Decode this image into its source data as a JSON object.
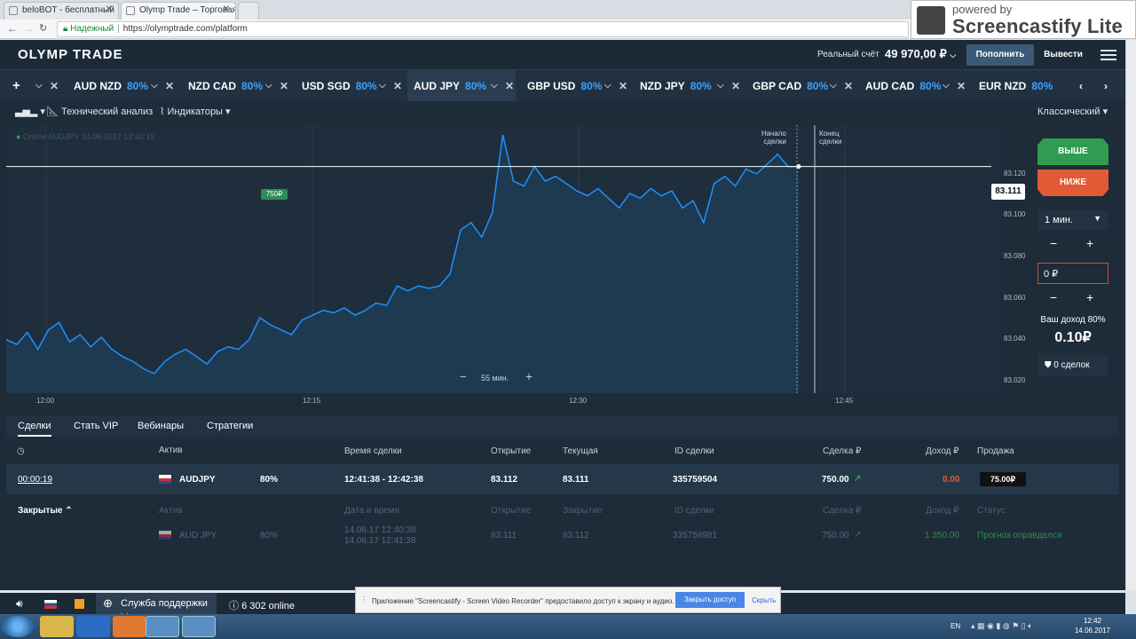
{
  "browser": {
    "tabs": [
      {
        "title": "beloBOT - бесплатный"
      },
      {
        "title": "Olymp Trade – Торговая"
      }
    ],
    "secure_label": "Надежный",
    "url": "https://olymptrade.com/platform"
  },
  "overlay": {
    "powered_by": "powered by",
    "name": "Screencastify Lite"
  },
  "header": {
    "logo": "OLYMP TRADE",
    "balance_label": "Реальный счёт",
    "balance_value": "49 970,00 ₽",
    "deposit_label": "Пополнить",
    "withdraw_label": "Вывести"
  },
  "assets": [
    {
      "name": "AUD NZD",
      "pct": "80%"
    },
    {
      "name": "NZD CAD",
      "pct": "80%"
    },
    {
      "name": "USD SGD",
      "pct": "80%"
    },
    {
      "name": "AUD JPY",
      "pct": "80%",
      "active": true
    },
    {
      "name": "GBP USD",
      "pct": "80%"
    },
    {
      "name": "NZD JPY",
      "pct": "80%"
    },
    {
      "name": "GBP CAD",
      "pct": "80%"
    },
    {
      "name": "AUD CAD",
      "pct": "80%"
    },
    {
      "name": "EUR NZD",
      "pct": "80%"
    }
  ],
  "toolbar": {
    "tech_analysis": "Технический анализ",
    "indicators": "Индикаторы",
    "chart_style": "Классический"
  },
  "chart_data": {
    "type": "area",
    "online_label": "Online AUDJPY 14.06.2017 12:42:19",
    "x_ticks": [
      "12:00",
      "12:15",
      "12:30",
      "12:45"
    ],
    "y_ticks": [
      "83.120",
      "83.100",
      "83.080",
      "83.060",
      "83.040",
      "83.020"
    ],
    "ylim": [
      83.018,
      83.128
    ],
    "current_price": "83.111",
    "amount_marker": "750₽",
    "deal_start_label": [
      "Начало",
      "сделки"
    ],
    "deal_end_label": [
      "Конец",
      "сделки"
    ],
    "zoom_label": "55 мин.",
    "series": [
      {
        "points": [
          [
            0,
            83.04
          ],
          [
            1,
            83.038
          ],
          [
            2,
            83.043
          ],
          [
            3,
            83.036
          ],
          [
            4,
            83.044
          ],
          [
            5,
            83.047
          ],
          [
            6,
            83.039
          ],
          [
            7,
            83.042
          ],
          [
            8,
            83.037
          ],
          [
            9,
            83.041
          ],
          [
            10,
            83.036
          ],
          [
            11,
            83.033
          ],
          [
            12,
            83.031
          ],
          [
            13,
            83.028
          ],
          [
            14,
            83.026
          ],
          [
            15,
            83.031
          ],
          [
            16,
            83.034
          ],
          [
            17,
            83.036
          ],
          [
            18,
            83.033
          ],
          [
            19,
            83.03
          ],
          [
            20,
            83.035
          ],
          [
            21,
            83.037
          ],
          [
            22,
            83.036
          ],
          [
            23,
            83.04
          ],
          [
            24,
            83.049
          ],
          [
            25,
            83.046
          ],
          [
            26,
            83.044
          ],
          [
            27,
            83.042
          ],
          [
            28,
            83.048
          ],
          [
            29,
            83.05
          ],
          [
            30,
            83.052
          ],
          [
            31,
            83.051
          ],
          [
            32,
            83.053
          ],
          [
            33,
            83.05
          ],
          [
            34,
            83.052
          ],
          [
            35,
            83.055
          ],
          [
            36,
            83.054
          ],
          [
            37,
            83.062
          ],
          [
            38,
            83.06
          ],
          [
            39,
            83.062
          ],
          [
            40,
            83.061
          ],
          [
            41,
            83.062
          ],
          [
            42,
            83.067
          ],
          [
            43,
            83.085
          ],
          [
            44,
            83.088
          ],
          [
            45,
            83.082
          ],
          [
            46,
            83.092
          ],
          [
            47,
            83.124
          ],
          [
            48,
            83.105
          ],
          [
            49,
            83.103
          ],
          [
            50,
            83.111
          ],
          [
            51,
            83.105
          ],
          [
            52,
            83.107
          ],
          [
            53,
            83.104
          ],
          [
            54,
            83.101
          ],
          [
            55,
            83.099
          ],
          [
            56,
            83.102
          ],
          [
            57,
            83.098
          ],
          [
            58,
            83.094
          ],
          [
            59,
            83.1
          ],
          [
            60,
            83.098
          ],
          [
            61,
            83.102
          ],
          [
            62,
            83.099
          ],
          [
            63,
            83.101
          ],
          [
            64,
            83.094
          ],
          [
            65,
            83.097
          ],
          [
            66,
            83.088
          ],
          [
            67,
            83.104
          ],
          [
            68,
            83.107
          ],
          [
            69,
            83.103
          ],
          [
            70,
            83.11
          ],
          [
            71,
            83.108
          ],
          [
            72,
            83.112
          ],
          [
            73,
            83.116
          ],
          [
            74,
            83.111
          ],
          [
            75,
            83.111
          ]
        ]
      }
    ]
  },
  "panel": {
    "up_label": "ВЫШЕ",
    "down_label": "НИЖЕ",
    "time_value": "1 мин.",
    "amount_value": "0 ₽",
    "income_label": "Ваш доход 80%",
    "income_value": "0.10₽",
    "deals_label": "0 сделок"
  },
  "bottom_tabs": [
    "Сделки",
    "Стать VIP",
    "Вебинары",
    "Стратегии"
  ],
  "open_headers": [
    "Актив",
    "Время сделки",
    "Открытие",
    "Текущая",
    "ID сделки",
    "Сделка ₽",
    "Доход ₽",
    "Продажа"
  ],
  "open_row": {
    "timer": "00:00:19",
    "asset": "AUDJPY",
    "pct": "80%",
    "time": "12:41:38 - 12:42:38",
    "open": "83.112",
    "current": "83.111",
    "id": "335759504",
    "amount": "750.00",
    "income": "0.00",
    "sell": "75.00₽"
  },
  "closed_label": "Закрытые",
  "closed_headers": [
    "Актив",
    "Дата и время",
    "Открытие",
    "Закрытие",
    "ID сделки",
    "Сделка ₽",
    "Доход ₽",
    "Статус"
  ],
  "closed_row": {
    "asset": "AUD JPY",
    "pct": "80%",
    "date1": "14.06.17 12:40:38",
    "date2": "14.06.17 12:41:38",
    "open": "83.111",
    "close": "83.112",
    "id": "335758981",
    "amount": "750.00",
    "income": "1 350.00",
    "status": "Прогноз оправдался"
  },
  "footer": {
    "support": "Служба поддержки",
    "online": "6 302 online"
  },
  "notification": {
    "text": "Приложение \"Screencastify - Screen Video Recorder\" предоставило доступ к экрану и аудио.",
    "stop": "Закрыть доступ",
    "hide": "Скрыть"
  },
  "taskbar": {
    "lang": "EN",
    "time": "12:42",
    "date": "14.06.2017"
  },
  "colors": {
    "up": "#2f9c52",
    "down": "#e05a35",
    "line": "#1e90ff",
    "accent_pct": "#3ea0ff"
  }
}
